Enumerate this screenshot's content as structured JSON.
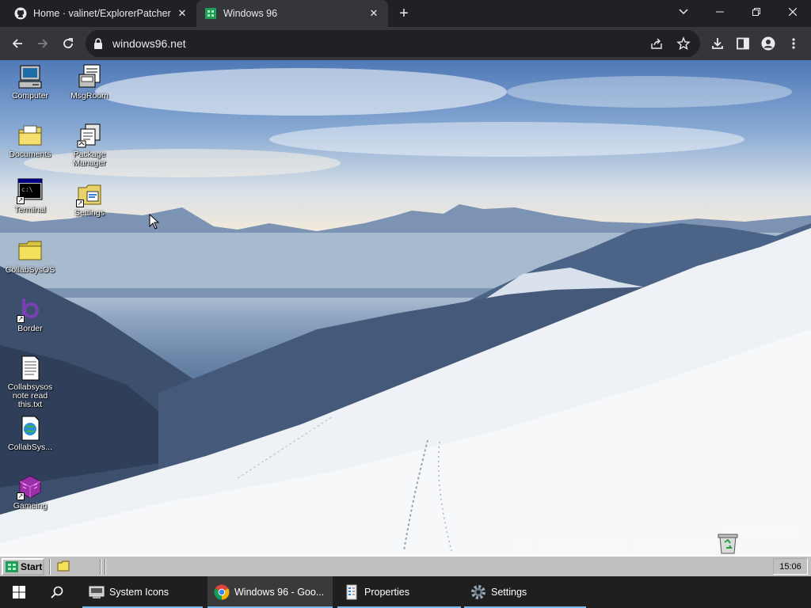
{
  "browser": {
    "tabs": [
      {
        "title": "Home · valinet/ExplorerPatcher",
        "favicon": "github-icon"
      },
      {
        "title": "Windows 96",
        "favicon": "windows96-icon"
      }
    ],
    "url": "windows96.net"
  },
  "desktop": {
    "icons": [
      {
        "label": "Computer",
        "icon": "computer-icon"
      },
      {
        "label": "MsgRoom",
        "icon": "msgroom-icon"
      },
      {
        "label": "Documents",
        "icon": "documents-folder-icon"
      },
      {
        "label": "Package Manager",
        "icon": "package-manager-icon"
      },
      {
        "label": "Terminal",
        "icon": "terminal-icon"
      },
      {
        "label": "Settings",
        "icon": "settings-icon"
      },
      {
        "label": "CollabSysOS",
        "icon": "folder-icon"
      },
      {
        "label": "Border",
        "icon": "border-icon"
      },
      {
        "label": "Collabsysos note read this.txt",
        "icon": "text-file-icon"
      },
      {
        "label": "CollabSys...",
        "icon": "globe-app-icon"
      },
      {
        "label": "Gameing",
        "icon": "gameing-icon"
      }
    ],
    "watermark_line1": "Windows 96 main",
    "watermark_line2": "rust 1.4.0+06b2a5c bbf4e 10/12/22 pre-beta 11:57"
  },
  "w96_taskbar": {
    "start_label": "Start",
    "clock": "15:06"
  },
  "windows_taskbar": {
    "apps": [
      {
        "label": "System Icons",
        "icon": "system-icons-icon",
        "active": false
      },
      {
        "label": "Windows 96 - Goo...",
        "icon": "chrome-icon",
        "active": true
      },
      {
        "label": "Properties",
        "icon": "properties-icon",
        "active": false
      },
      {
        "label": "Settings",
        "icon": "gear-icon",
        "active": false
      }
    ]
  },
  "colors": {
    "chrome_bg": "#202124",
    "chrome_toolbar": "#35363a",
    "w96_gray": "#c0c0c0",
    "taskbar_bg": "#1f1f1f",
    "taskbar_accent": "#76b9ed"
  }
}
